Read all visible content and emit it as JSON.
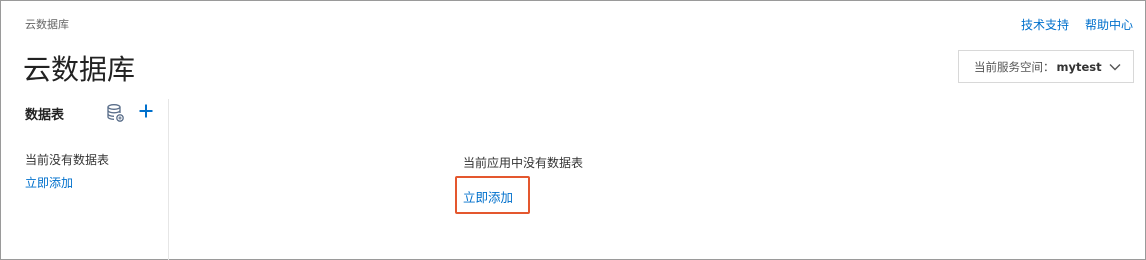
{
  "header": {
    "breadcrumb": "云数据库",
    "title": "云数据库",
    "links": {
      "support": "技术支持",
      "help": "帮助中心"
    },
    "space_selector": {
      "label": "当前服务空间：",
      "value": "mytest",
      "icon": "chevron-down-icon"
    }
  },
  "sidebar": {
    "title": "数据表",
    "icons": [
      "database-icon",
      "plus-icon"
    ],
    "empty_text": "当前没有数据表",
    "add_link": "立即添加"
  },
  "main": {
    "empty_text": "当前应用中没有数据表",
    "add_link": "立即添加",
    "highlight_color": "#e4572e"
  },
  "colors": {
    "link": "#0070cc",
    "text": "#333333"
  }
}
